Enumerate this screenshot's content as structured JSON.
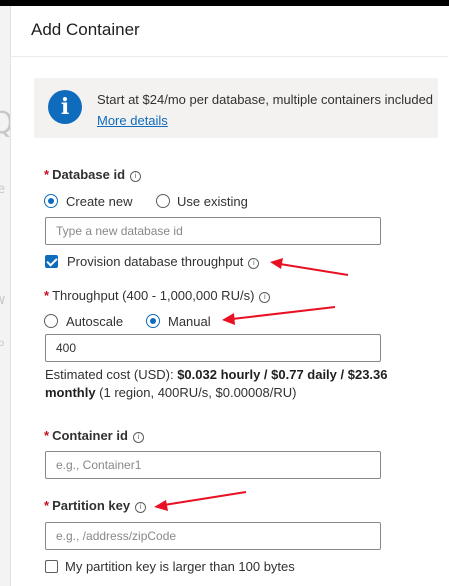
{
  "dialog": {
    "title": "Add Container"
  },
  "info": {
    "icon": "info-icon",
    "text": "Start at $24/mo per database, multiple containers included",
    "link": "More details"
  },
  "database": {
    "label": "Database id",
    "options": [
      {
        "label": "Create new",
        "selected": true
      },
      {
        "label": "Use existing",
        "selected": false
      }
    ],
    "input_placeholder": "Type a new database id",
    "provision_label": "Provision database throughput",
    "provision_checked": true
  },
  "throughput": {
    "label": "Throughput (400 - 1,000,000 RU/s)",
    "options": [
      {
        "label": "Autoscale",
        "selected": false
      },
      {
        "label": "Manual",
        "selected": true
      }
    ],
    "value": "400",
    "cost_prefix": "Estimated cost (USD): ",
    "cost_bold_1": "$0.032 hourly / $0.77 daily / $23.36",
    "cost_bold_2": "monthly",
    "cost_suffix": " (1 region, 400RU/s, $0.00008/RU)"
  },
  "container": {
    "label": "Container id",
    "placeholder": "e.g., Container1"
  },
  "partition": {
    "label": "Partition key",
    "placeholder": "e.g., /address/zipCode",
    "large_key_label": "My partition key is larger than 100 bytes",
    "large_key_checked": false
  },
  "colors": {
    "accent": "#0f6cbd",
    "required": "#c50f1f",
    "annotation_arrow": "#e81123"
  }
}
